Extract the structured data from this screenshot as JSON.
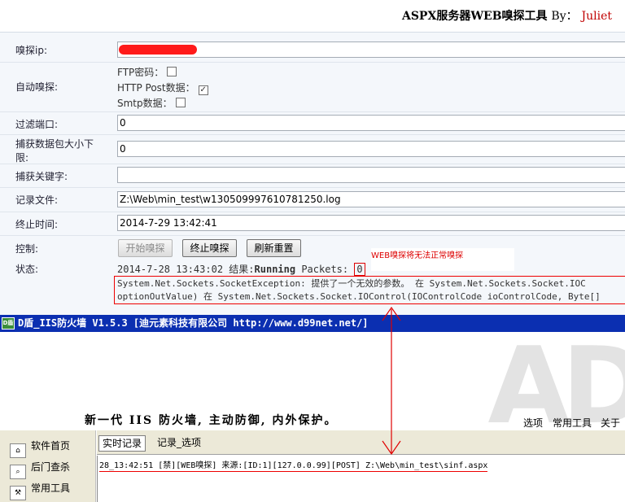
{
  "header": {
    "title": "ASPX服务器WEB嗅探工具",
    "by": "By：",
    "author": "Juliet"
  },
  "form": {
    "sniff_ip_label": "嗅探ip:",
    "auto_sniff_label": "自动嗅探:",
    "ftp_label": "FTP密码：",
    "http_label": "HTTP Post数据：",
    "smtp_label": "Smtp数据：",
    "http_checked_mark": "✓",
    "port_filter_label": "过滤端口:",
    "port_filter_value": "0",
    "min_packet_label_1": "捕获数据包大小下",
    "min_packet_label_2": "限:",
    "min_packet_value": "0",
    "keyword_label": "捕获关键字:",
    "keyword_value": "",
    "log_file_label": "记录文件:",
    "log_file_value": "Z:\\Web\\min_test\\w130509997610781250.log",
    "end_time_label": "终止时间:",
    "end_time_value": "2014-7-29 13:42:41",
    "control_label": "控制:",
    "start_button": "开始嗅探",
    "stop_button": "终止嗅探",
    "reset_button": "刷新重置",
    "status_label": "状态:",
    "status_time": "2014-7-28 13:43:02",
    "status_result_label": "结果:",
    "status_result": "Running",
    "status_packets_label": "Packets:",
    "status_packets": "0",
    "warning_note": "WEB嗅探将无法正常嗅探",
    "error_line_1": "System.Net.Sockets.SocketException: 提供了一个无效的参数。 在 System.Net.Sockets.Socket.IOC",
    "error_line_2": "optionOutValue) 在 System.Net.Sockets.Socket.IOControl(IOControlCode ioControlCode, Byte[]"
  },
  "firewall": {
    "logo": "D盾",
    "title": "D盾_IIS防火墙 V1.5.3 [迪元素科技有限公司 http://www.d99net.net/]",
    "watermark": "AD",
    "slogan": "新一代 IIS 防火墙, 主动防御, 内外保护。",
    "menu": [
      "选项",
      "常用工具",
      "关于"
    ],
    "left_items": [
      {
        "label": "软件首页",
        "icon": "home-icon"
      },
      {
        "label": "后门查杀",
        "icon": "scan-icon"
      },
      {
        "label": "常用工具",
        "icon": "tools-icon"
      }
    ],
    "tabs": [
      "实时记录",
      "记录_选项"
    ],
    "log_line": "28_13:42:51 [禁][WEB嗅探] 来源:[ID:1][127.0.0.99][POST] Z:\\Web\\min_test\\sinf.aspx"
  },
  "colors": {
    "firewall_title_bg": "#0b2fb1",
    "highlight_red": "#e00000",
    "author_red": "#c00000"
  }
}
